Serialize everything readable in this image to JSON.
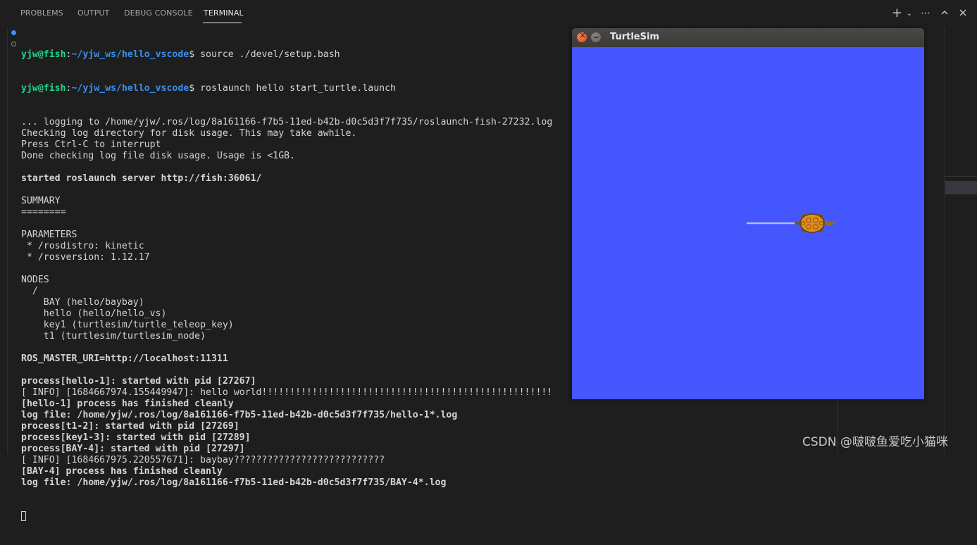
{
  "panel": {
    "tabs": [
      {
        "label": "PROBLEMS",
        "active": false
      },
      {
        "label": "OUTPUT",
        "active": false
      },
      {
        "label": "DEBUG CONSOLE",
        "active": false
      },
      {
        "label": "TERMINAL",
        "active": true
      }
    ],
    "actions": [
      "plus-icon",
      "chevron-down-icon",
      "more-icon",
      "chevron-up-icon",
      "close-icon"
    ]
  },
  "terminal": {
    "prompt1": {
      "user": "yjw@fish",
      "path": "~/yjw_ws/hello_vscode",
      "symbol": "$ ",
      "command": "source ./devel/setup.bash"
    },
    "prompt2": {
      "user": "yjw@fish",
      "path": "~/yjw_ws/hello_vscode",
      "symbol": "$ ",
      "command": "roslaunch hello start_turtle.launch"
    },
    "lines": [
      {
        "text": "... logging to /home/yjw/.ros/log/8a161166-f7b5-11ed-b42b-d0c5d3f7f735/roslaunch-fish-27232.log",
        "bold": false
      },
      {
        "text": "Checking log directory for disk usage. This may take awhile.",
        "bold": false
      },
      {
        "text": "Press Ctrl-C to interrupt",
        "bold": false
      },
      {
        "text": "Done checking log file disk usage. Usage is <1GB.",
        "bold": false
      },
      {
        "text": "",
        "bold": false
      },
      {
        "text": "started roslaunch server http://fish:36061/",
        "bold": true
      },
      {
        "text": "",
        "bold": false
      },
      {
        "text": "SUMMARY",
        "bold": false
      },
      {
        "text": "========",
        "bold": false
      },
      {
        "text": "",
        "bold": false
      },
      {
        "text": "PARAMETERS",
        "bold": false
      },
      {
        "text": " * /rosdistro: kinetic",
        "bold": false
      },
      {
        "text": " * /rosversion: 1.12.17",
        "bold": false
      },
      {
        "text": "",
        "bold": false
      },
      {
        "text": "NODES",
        "bold": false
      },
      {
        "text": "  /",
        "bold": false
      },
      {
        "text": "    BAY (hello/baybay)",
        "bold": false
      },
      {
        "text": "    hello (hello/hello_vs)",
        "bold": false
      },
      {
        "text": "    key1 (turtlesim/turtle_teleop_key)",
        "bold": false
      },
      {
        "text": "    t1 (turtlesim/turtlesim_node)",
        "bold": false
      },
      {
        "text": "",
        "bold": false
      },
      {
        "text": "ROS_MASTER_URI=http://localhost:11311",
        "bold": true
      },
      {
        "text": "",
        "bold": false
      },
      {
        "text": "process[hello-1]: started with pid [27267]",
        "bold": true
      },
      {
        "text": "[ INFO] [1684667974.155449947]: hello world!!!!!!!!!!!!!!!!!!!!!!!!!!!!!!!!!!!!!!!!!!!!!!!!!!!!",
        "bold": false
      },
      {
        "text": "[hello-1] process has finished cleanly",
        "bold": true
      },
      {
        "text": "log file: /home/yjw/.ros/log/8a161166-f7b5-11ed-b42b-d0c5d3f7f735/hello-1*.log",
        "bold": true
      },
      {
        "text": "process[t1-2]: started with pid [27269]",
        "bold": true
      },
      {
        "text": "process[key1-3]: started with pid [27289]",
        "bold": true
      },
      {
        "text": "process[BAY-4]: started with pid [27297]",
        "bold": true
      },
      {
        "text": "[ INFO] [1684667975.220557671]: baybay???????????????????????????",
        "bold": false
      },
      {
        "text": "[BAY-4] process has finished cleanly",
        "bold": true
      },
      {
        "text": "log file: /home/yjw/.ros/log/8a161166-f7b5-11ed-b42b-d0c5d3f7f735/BAY-4*.log",
        "bold": true
      }
    ]
  },
  "turtlesim": {
    "title": "TurtleSim",
    "background": "#4556ff",
    "trail_color": "#b3b8ff"
  },
  "colors": {
    "user": "#23d18b",
    "path": "#3b8eea",
    "dot_active": "#3794ff",
    "dot_idle": "#8b8b8b"
  },
  "watermark": "CSDN @啵啵鱼爱吃小猫咪"
}
